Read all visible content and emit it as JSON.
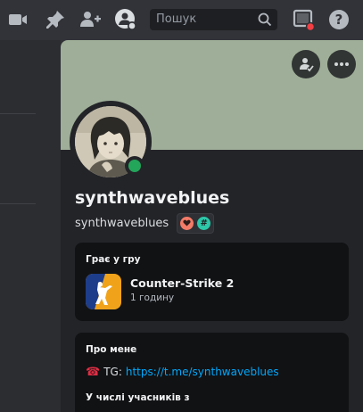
{
  "toolbar": {
    "icons": [
      "video-icon",
      "pin-icon",
      "add-member-icon",
      "member-list-icon",
      "inbox-icon",
      "help-icon"
    ],
    "search_placeholder": "Пошук"
  },
  "profile": {
    "display_name": "synthwaveblues",
    "username": "synthwaveblues",
    "status": "online",
    "badges": [
      {
        "name": "heart-badge",
        "color": "#f47b67",
        "glyph": "♥"
      },
      {
        "name": "hashtag-badge",
        "color": "#2dc7aa",
        "glyph": "#"
      }
    ],
    "banner_color": "#9fae98"
  },
  "activity": {
    "title": "Грає у гру",
    "game_name": "Counter-Strike 2",
    "duration": "1 годину"
  },
  "about": {
    "title": "Про мене",
    "tg_label": "TG:",
    "tg_link": "https://t.me/synthwaveblues"
  },
  "members": {
    "title": "У числі учасників з"
  }
}
